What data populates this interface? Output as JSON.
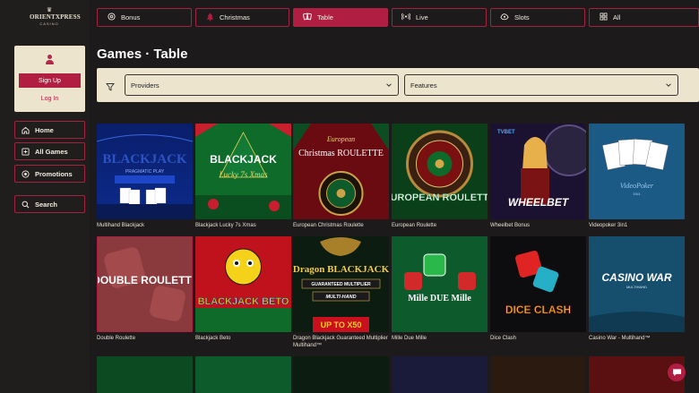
{
  "brand": {
    "name": "ORIENTXPRESS",
    "sub": "CASINO"
  },
  "user_card": {
    "signup": "Sign Up",
    "login": "Log In"
  },
  "sidebar": {
    "items": [
      {
        "label": "Home",
        "icon": "home-icon"
      },
      {
        "label": "All Games",
        "icon": "games-icon"
      },
      {
        "label": "Promotions",
        "icon": "promotions-icon"
      },
      {
        "label": "Search",
        "icon": "search-icon"
      }
    ]
  },
  "tabs": [
    {
      "label": "Bonus",
      "icon": "bonus-icon"
    },
    {
      "label": "Christmas",
      "icon": "tree-icon"
    },
    {
      "label": "Table",
      "icon": "cards-icon",
      "active": true
    },
    {
      "label": "Live",
      "icon": "live-icon"
    },
    {
      "label": "Slots",
      "icon": "slots-icon"
    },
    {
      "label": "All",
      "icon": "grid-icon"
    }
  ],
  "page_title": "Games · Table",
  "filters": {
    "providers": "Providers",
    "features": "Features"
  },
  "games_row1": [
    {
      "name": "Multihand Blackjack",
      "art_title": "BLACKJACK",
      "art_sub": "PRAGMATIC PLAY"
    },
    {
      "name": "Blackjack Lucky 7s Xmas",
      "art_title": "BLACKJACK",
      "art_sub": "Lucky 7s Xmas"
    },
    {
      "name": "European Christmas Roulette",
      "art_title": "Christmas ROULETTE",
      "art_sub": "European"
    },
    {
      "name": "European Roulette",
      "art_title": "EUROPEAN ROULETTE",
      "art_sub": ""
    },
    {
      "name": "Wheelbet Bonus",
      "art_title": "WHEELBET",
      "art_sub": "TVBET"
    },
    {
      "name": "Videopoker 3in1",
      "art_title": "VideoPoker",
      "art_sub": "3IN1"
    }
  ],
  "games_row2": [
    {
      "name": "Double Roulette",
      "art_title": "DOUBLE ROULETTE",
      "art_sub": ""
    },
    {
      "name": "Blackjack Beto",
      "art_title": "BLACKJACK BETO",
      "art_sub": ""
    },
    {
      "name": "Dragon Blackjack Guaranteed Multiplier Multihand™",
      "art_title": "Dragon BLACKJACK",
      "art_sub": "GUARANTEED MULTIPLIER",
      "art_extra": "MULTI-HAND",
      "art_extra2": "UP TO X50"
    },
    {
      "name": "Mille Due Mille",
      "art_title": "Mille DUE Mille",
      "art_sub": ""
    },
    {
      "name": "Dice Clash",
      "art_title": "DICE CLASH",
      "art_sub": ""
    },
    {
      "name": "Casino War - Multihand™",
      "art_title": "CASINO WAR",
      "art_sub": "MULTIHAND"
    }
  ],
  "colors": {
    "accent": "#b01f41",
    "cream": "#ece4cc",
    "bg": "#1c1a1a"
  }
}
